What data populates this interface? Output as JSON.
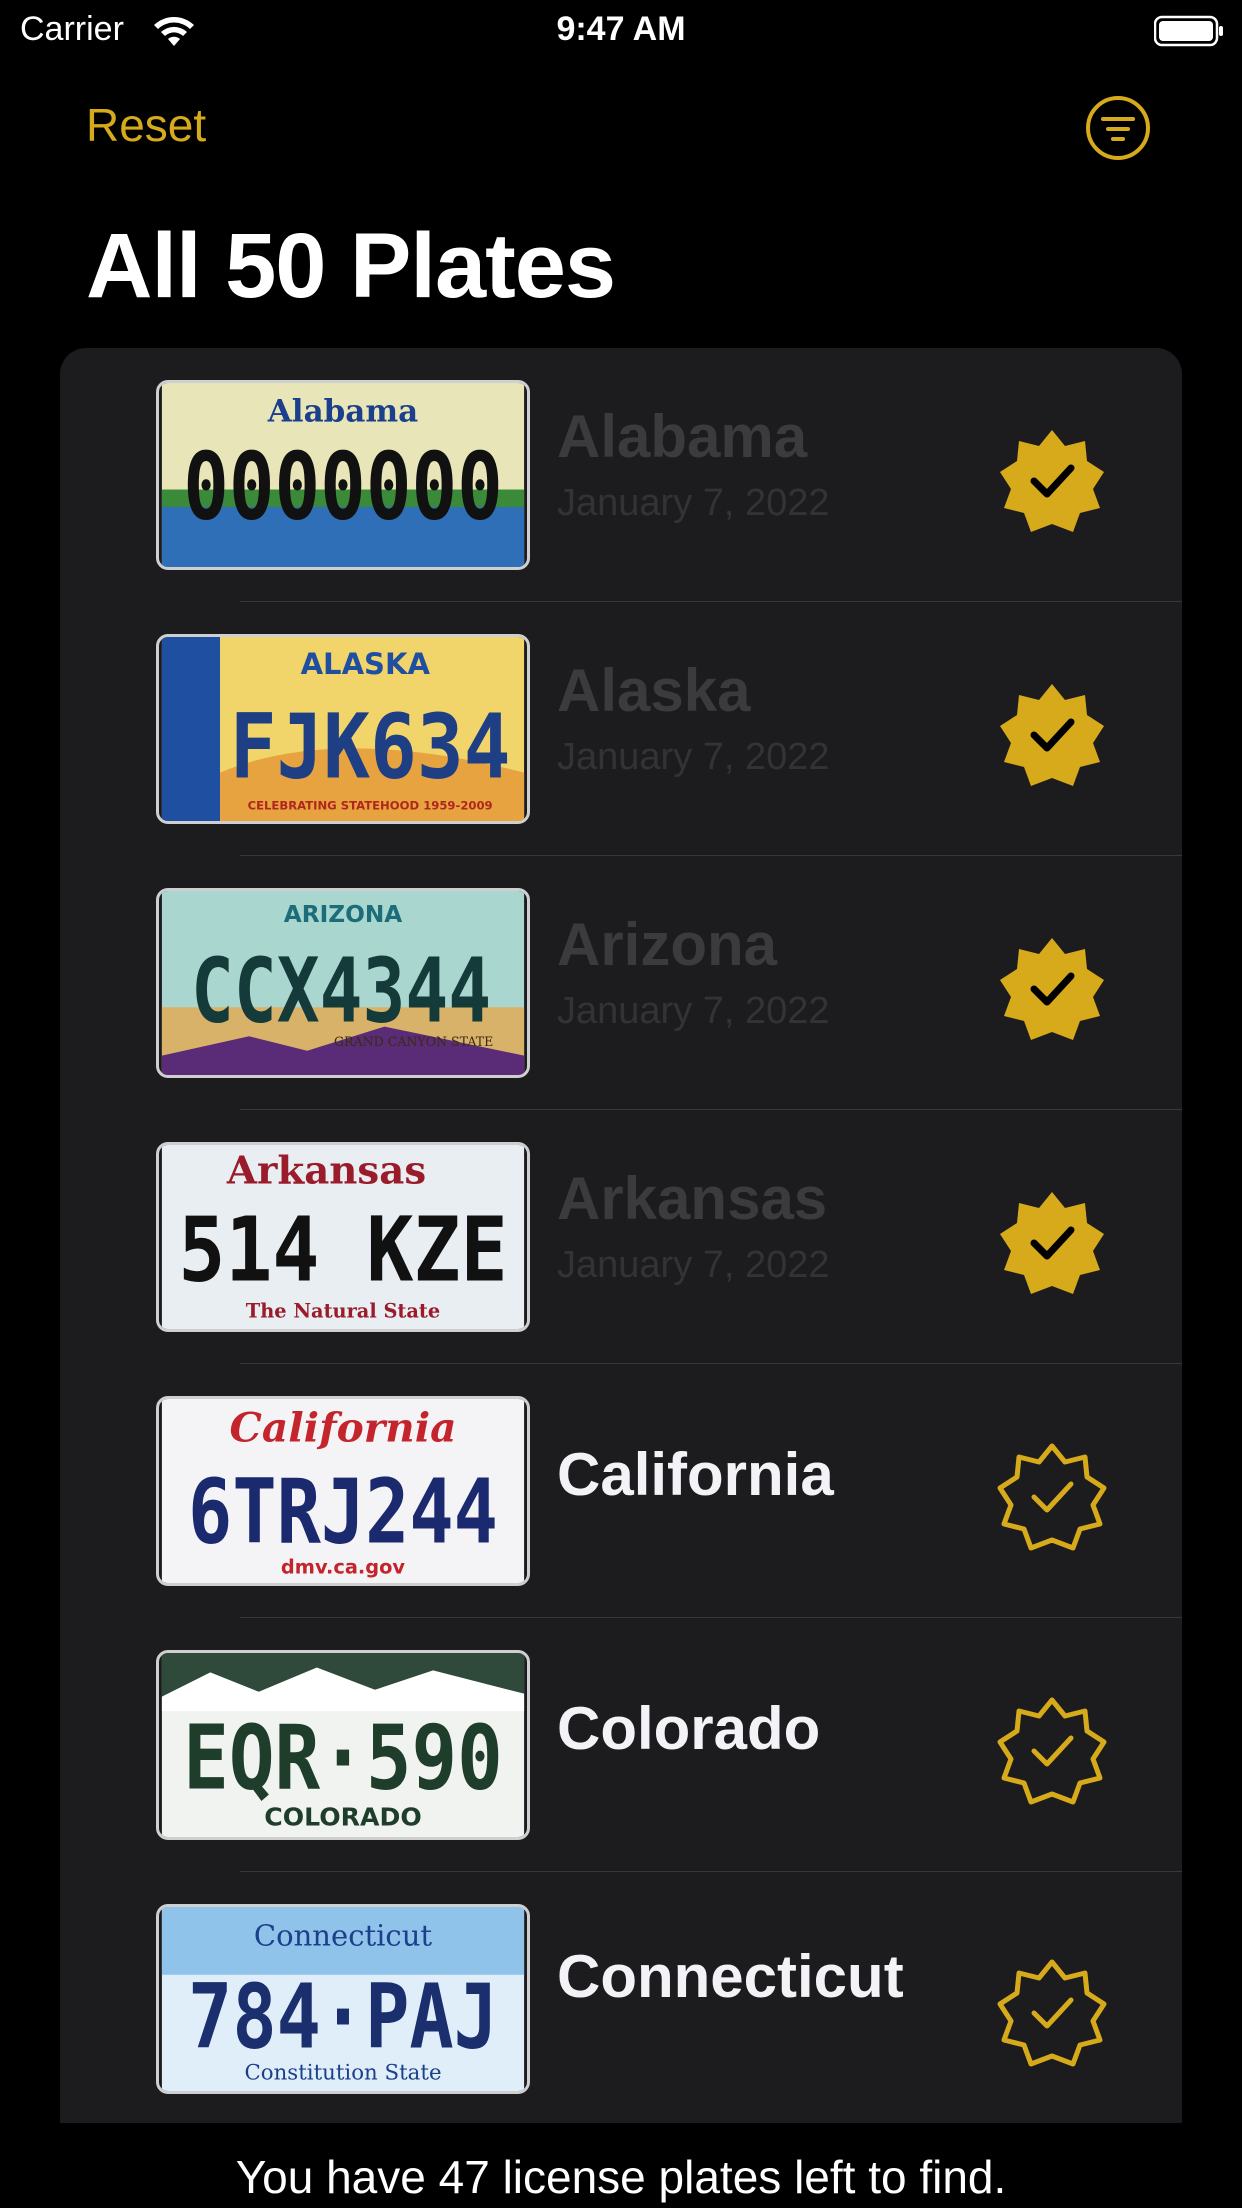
{
  "status_bar": {
    "carrier": "Carrier",
    "time": "9:47 AM"
  },
  "nav": {
    "reset_label": "Reset",
    "filter_icon": "filter-circle-icon",
    "accent_color": "#d6aa1a"
  },
  "page_title": "All 50 Plates",
  "plates": [
    {
      "state": "Alabama",
      "date": "January 7, 2022",
      "found": true,
      "plate_number": "0000000",
      "plate_header": "Alabama",
      "plate_footer": ""
    },
    {
      "state": "Alaska",
      "date": "January 7, 2022",
      "found": true,
      "plate_number": "FJK634",
      "plate_header": "ALASKA",
      "plate_footer": "CELEBRATING STATEHOOD 1959-2009"
    },
    {
      "state": "Arizona",
      "date": "January 7, 2022",
      "found": true,
      "plate_number": "CCX4344",
      "plate_header": "ARIZONA",
      "plate_footer": "GRAND CANYON STATE"
    },
    {
      "state": "Arkansas",
      "date": "January 7, 2022",
      "found": true,
      "plate_number": "514 KZE",
      "plate_header": "Arkansas",
      "plate_footer": "The Natural State"
    },
    {
      "state": "California",
      "date": "",
      "found": false,
      "plate_number": "6TRJ244",
      "plate_header": "California",
      "plate_footer": "dmv.ca.gov"
    },
    {
      "state": "Colorado",
      "date": "",
      "found": false,
      "plate_number": "EQR·590",
      "plate_header": "",
      "plate_footer": "COLORADO"
    },
    {
      "state": "Connecticut",
      "date": "",
      "found": false,
      "plate_number": "784·PAJ",
      "plate_header": "Connecticut",
      "plate_footer": "Constitution State"
    }
  ],
  "footer_message": "You have 47 license plates left to find."
}
